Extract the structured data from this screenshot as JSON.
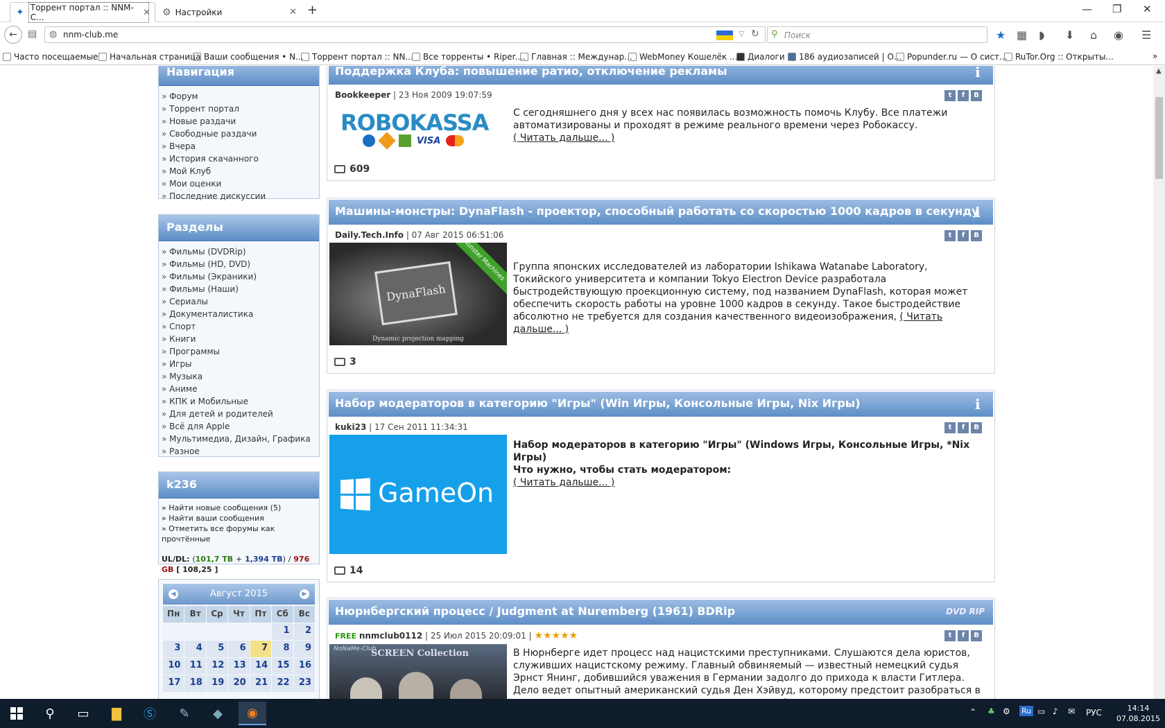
{
  "browser": {
    "tabs": [
      {
        "title": "Торрент портал :: NNM-C..."
      },
      {
        "title": "Настройки"
      }
    ],
    "new_tab": "+",
    "window": {
      "minimize": "—",
      "maximize": "❐",
      "close": "✕"
    },
    "url": "nnm-club.me",
    "search_placeholder": "Поиск",
    "bookmarks": [
      "Часто посещаемые",
      "Начальная страница",
      "Ваши сообщения • N...",
      "Торрент портал :: NN...",
      "Все торренты • Riper....",
      "Главная :: Междунар...",
      "WebMoney Кошелёк ...",
      "Диалоги",
      "186 аудиозаписей | О...",
      "Popunder.ru — О сист...",
      "RuTor.Org :: Открыты..."
    ]
  },
  "sidebar": {
    "nav": {
      "title": "Навигация",
      "items": [
        "Форум",
        "Торрент портал",
        "Новые раздачи",
        "Свободные раздачи",
        "Вчера",
        "История скачанного",
        "Мой Клуб",
        "Мои оценки",
        "Последние дискуссии"
      ]
    },
    "sections": {
      "title": "Разделы",
      "items": [
        "Фильмы (DVDRip)",
        "Фильмы (HD, DVD)",
        "Фильмы (Экраники)",
        "Фильмы (Наши)",
        "Сериалы",
        "Документалистика",
        "Спорт",
        "Книги",
        "Программы",
        "Игры",
        "Музыка",
        "Аниме",
        "КПК и Мобильные",
        "Для детей и родителей",
        "Всё для Apple",
        "Мультимедиа, Дизайн, Графика",
        "Разное"
      ]
    },
    "user": {
      "title": "k236",
      "links": [
        "» Найти новые сообщения (5)",
        "» Найти ваши сообщения",
        "» Отметить все форумы как прочтённые"
      ],
      "ul_label": "UL/DL:",
      "ul_open": "(",
      "ul_value": "101,7 ТВ",
      "ul_plus": "+",
      "ul_bonus": "1,394 ТВ",
      "ul_close": ")",
      "ul_sep": "/",
      "dl_value": "976 GB",
      "ratio": "[ 108,25 ]"
    },
    "calendar": {
      "month": "Август 2015",
      "prev": "◀",
      "next": "▶",
      "days_of_week": [
        "Пн",
        "Вт",
        "Ср",
        "Чт",
        "Пт",
        "Сб",
        "Вс"
      ],
      "rows": [
        [
          "",
          "",
          "",
          "",
          "",
          "1",
          "2"
        ],
        [
          "3",
          "4",
          "5",
          "6",
          "7",
          "8",
          "9"
        ],
        [
          "10",
          "11",
          "12",
          "13",
          "14",
          "15",
          "16"
        ],
        [
          "17",
          "18",
          "19",
          "20",
          "21",
          "22",
          "23"
        ]
      ],
      "today": "7"
    }
  },
  "posts": [
    {
      "title": "Поддержка Клуба: повышение ратио, отключение рекламы",
      "author": "Bookkeeper",
      "date": "| 23 Ноя 2009 19:07:59",
      "image_text": "ROBOKASSA",
      "image_sub": "VISA",
      "text": "С сегодняшнего дня у всех нас появилась возможность помочь Клубу. Все платежи автоматизированы и проходят в режиме реального времени через Робокассу.",
      "more": "( Читать дальше... )",
      "comments": "609"
    },
    {
      "title": "Машины-монстры: DynaFlash - проектор, способный работать со скоростью 1000 кадров в секунду",
      "author": "Daily.Tech.Info",
      "date": "| 07 Авг 2015 06:51:06",
      "image_text": "DynaFlash",
      "image_badge": "Monster Machines",
      "image_caption": "Dynamic projection mapping",
      "text": "Группа японских исследователей из лаборатории Ishikawa Watanabe Laboratory, Токийского университета и компании Tokyo Electron Device разработала быстродействующую проекционную систему, под названием DynaFlash, которая может обеспечить скорость работы на уровне 1000 кадров в секунду. Такое быстродействие абсолютно не требуется для создания качественного видеоизображения,",
      "more": "( Читать дальше... )",
      "comments": "3"
    },
    {
      "title": "Набор модераторов в категорию \"Игры\" (Win Игры, Консольные Игры, Nix Игры)",
      "author": "kuki23",
      "date": "| 17 Сен 2011 11:34:31",
      "image_text": "GameOn",
      "text_bold1": "Набор модераторов в категорию \"Игры\" (Windows Игры, Консольные Игры, *Nix Игры)",
      "text_bold2": "Что нужно, чтобы стать модератором:",
      "more": "( Читать дальше... )",
      "comments": "14"
    },
    {
      "title": "Нюрнбергский процесс / Judgment at Nuremberg (1961) BDRip",
      "free": "FREE",
      "author": "nnmclub0112",
      "date": "| 25 Июл 2015 20:09:01 |",
      "stars": "★★★★★",
      "badge": "DVD RIP",
      "image_text": "NoNaMe-Club",
      "image_sub": "SCREEN Collection",
      "text": "В Нюрнберге идет процесс над нацистскими преступниками. Слушаются дела юристов, служивших нацистскому режиму. Главный обвиняемый — известный немецкий судья Эрнст Янинг, добившийся уважения в Германии задолго до прихода к власти Гитлера. Дело ведет опытный американский судья Ден Хэйвуд, которому предстоит разобраться в этом сложном и неоднозначном деле, ведь на кону ("
    }
  ],
  "share": {
    "tw": "t",
    "fb": "f",
    "vk": "B"
  },
  "info_glyph": "i",
  "taskbar": {
    "lang_badge": "Ru",
    "lang": "РУС",
    "time": "14:14",
    "date": "07.08.2015"
  }
}
